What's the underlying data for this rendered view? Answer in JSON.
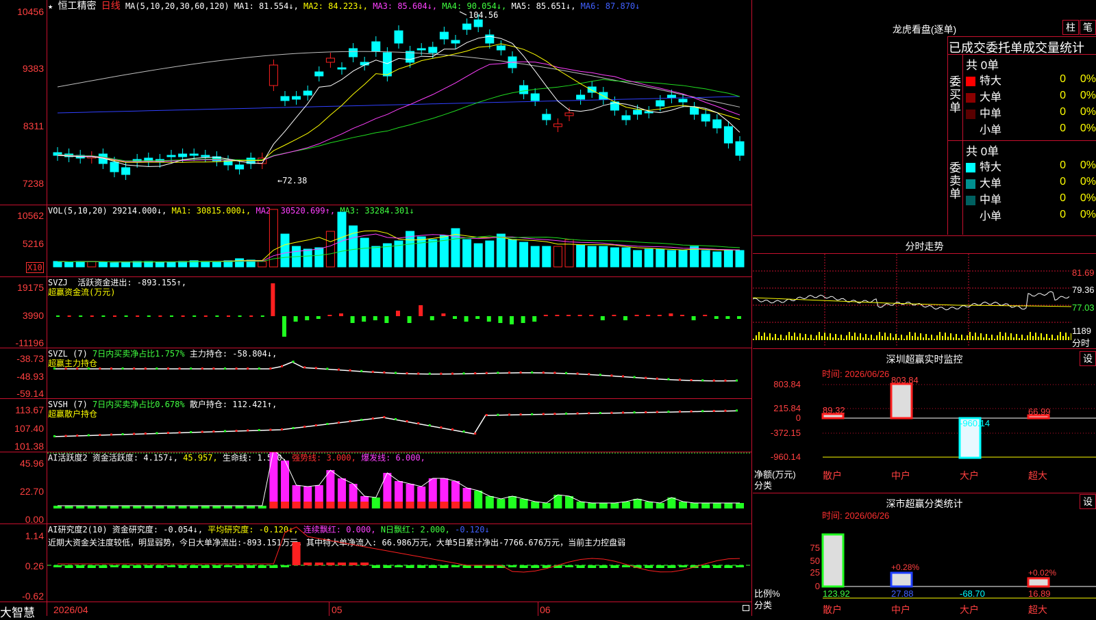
{
  "main_chart": {
    "star": "★",
    "stock_name": "恒工精密",
    "period": "日线",
    "ma_label": "MA(5,10,20,30,60,120)",
    "ma1": "MA1: 81.554↓,",
    "ma2": "MA2: 84.223↓,",
    "ma3": "MA3: 85.604↓,",
    "ma4": "MA4: 90.054↓,",
    "ma5": "MA5: 85.651↓,",
    "ma6": "MA6: 87.870↓",
    "high_marker": "104.56",
    "low_marker": "←72.38",
    "y_ticks": [
      "10456",
      "9383",
      "8311",
      "7238"
    ],
    "colors": {
      "up": "#ff2020",
      "down": "#00ffff",
      "ma1": "#ffffff",
      "ma2": "#ffff00",
      "ma3": "#ff40ff",
      "ma4": "#20ff20",
      "ma5": "#2020ff",
      "ma6": "#c0c0c0"
    }
  },
  "volume": {
    "title": "VOL(5,10,20)",
    "value": "29214.000↓,",
    "ma1": "MA1: 30815.000↓,",
    "ma2": "MA2: 30520.699↑,",
    "ma3": "MA3: 33284.301↓",
    "y_ticks": [
      "10562",
      "5216"
    ],
    "unit_badge": "X10"
  },
  "svzj": {
    "title": "SVZJ",
    "desc": "活跃资金进出: -893.155↑,",
    "sub": "超赢资金流(万元)",
    "y_ticks": [
      "19175",
      "3990",
      "-11196"
    ]
  },
  "svzl": {
    "title": "SVZL (7)",
    "desc1": "7日内买卖净占比1.757%",
    "desc2": "主力持仓: -58.804↓,",
    "sub": "超赢主力持仓",
    "y_ticks": [
      "-38.73",
      "-48.93",
      "-59.14"
    ]
  },
  "svsh": {
    "title": "SVSH (7)",
    "desc1": "7日内买卖净占比0.678%",
    "desc2": "散户持仓: 112.421↑,",
    "sub": "超赢散户持仓",
    "y_ticks": [
      "113.67",
      "107.40",
      "101.38"
    ]
  },
  "ai_active": {
    "title": "AI活跃度2",
    "a": "资金活跃度: 4.157↓,",
    "b": "45.957,",
    "c": "生命线: 1.560,",
    "d": "强势线: 3.000,",
    "e": "爆发线: 6.000,",
    "y_ticks": [
      "45.96",
      "22.70",
      "0.00"
    ]
  },
  "ai_research": {
    "title": "AI研究度2(10)",
    "a": "资金研究度: -0.054↓,",
    "b": "平均研究度: -0.120↓,",
    "c": "连续飘红: 0.000,",
    "d": "N日飘红: 2.000,",
    "e": "-0.120↓",
    "note": "近期大资金关注度较低，明显弱势，今日大单净流出:-893.151万元，其中特大单净流入: 66.986万元，大单5日累计净出-7766.676万元，当前主力控盘弱",
    "y_ticks": [
      "1.14",
      "0.26",
      "-0.62"
    ]
  },
  "bottom": {
    "logo": "大智慧",
    "date_label": "2026/04",
    "month5": "05",
    "month6": "06"
  },
  "longhu": {
    "title": "龙虎看盘(逐单)",
    "btn_zhu": "柱",
    "btn_bi": "笔",
    "header": "已成交委托单成交量统计",
    "buy_side": "委买单",
    "sell_side": "委卖单",
    "buy_total": "共 0单",
    "sell_total": "共 0单",
    "buy_rows": [
      {
        "name": "特大",
        "val": "0",
        "pct": "0%",
        "color": "#ff0000"
      },
      {
        "name": "大单",
        "val": "0",
        "pct": "0%",
        "color": "#8b0000"
      },
      {
        "name": "中单",
        "val": "0",
        "pct": "0%",
        "color": "#5a0000"
      },
      {
        "name": "小单",
        "val": "0",
        "pct": "0%",
        "color": "#000000"
      }
    ],
    "sell_rows": [
      {
        "name": "特大",
        "val": "0",
        "pct": "0%",
        "color": "#00ffff"
      },
      {
        "name": "大单",
        "val": "0",
        "pct": "0%",
        "color": "#009090"
      },
      {
        "name": "中单",
        "val": "0",
        "pct": "0%",
        "color": "#006060"
      },
      {
        "name": "小单",
        "val": "0",
        "pct": "0%",
        "color": "#000000"
      }
    ]
  },
  "intraday": {
    "title": "分时走势",
    "y_ticks": [
      "81.69",
      "79.36",
      "77.03",
      "1189"
    ],
    "tail_label": "分时"
  },
  "sz_monitor": {
    "title": "深圳超赢实时监控",
    "btn": "设",
    "time": "时间: 2026/06/26",
    "y_ticks": [
      "803.84",
      "215.84",
      "0",
      "-372.15",
      "-960.14"
    ],
    "y_title": "净额(万元)",
    "x_title": "分类",
    "categories": [
      "散户",
      "中户",
      "大户",
      "超大"
    ],
    "values": [
      "89.32",
      "803.84",
      "-960.14",
      "66.99"
    ]
  },
  "sz_class": {
    "title": "深市超赢分类统计",
    "btn": "设",
    "time": "时间: 2026/06/26",
    "y_ticks": [
      "75",
      "50",
      "25",
      "0"
    ],
    "y_title": "比例%",
    "x_title": "分类",
    "categories": [
      "散户",
      "中户",
      "大户",
      "超大"
    ],
    "values": [
      "123.92",
      "27.88",
      "-68.70",
      "16.89"
    ],
    "bar_labels": [
      "+0.28%",
      "+0.02%"
    ]
  }
}
